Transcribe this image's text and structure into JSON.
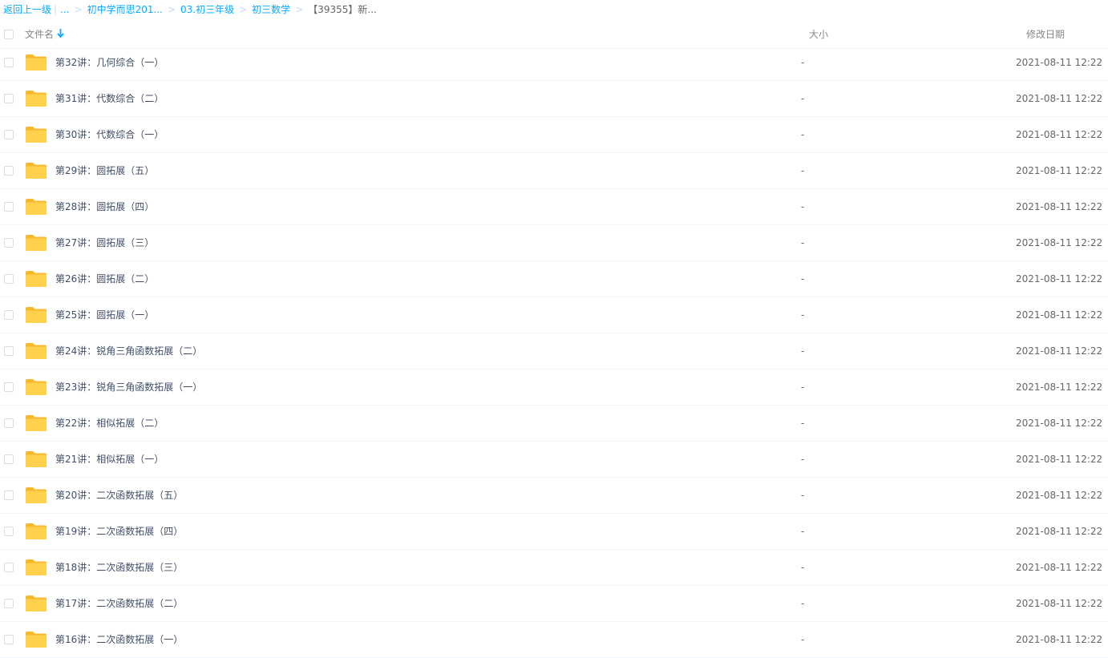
{
  "breadcrumb": {
    "back_label": "返回上一级",
    "pipe": "|",
    "items": [
      "...",
      "初中学而思201...",
      "03.初三年级",
      "初三数学"
    ],
    "current": "【39355】新...",
    "separator": ">"
  },
  "header": {
    "name_label": "文件名",
    "size_label": "大小",
    "date_label": "修改日期",
    "sort_icon": "arrow-down-icon"
  },
  "colors": {
    "accent": "#09aaff",
    "folder": "#ffd04b",
    "text": "#424e67"
  },
  "files": [
    {
      "name": "第32讲：几何综合（一）",
      "size": "-",
      "date": "2021-08-11 12:22"
    },
    {
      "name": "第31讲：代数综合（二）",
      "size": "-",
      "date": "2021-08-11 12:22"
    },
    {
      "name": "第30讲：代数综合（一）",
      "size": "-",
      "date": "2021-08-11 12:22"
    },
    {
      "name": "第29讲：圆拓展（五）",
      "size": "-",
      "date": "2021-08-11 12:22"
    },
    {
      "name": "第28讲：圆拓展（四）",
      "size": "-",
      "date": "2021-08-11 12:22"
    },
    {
      "name": "第27讲：圆拓展（三）",
      "size": "-",
      "date": "2021-08-11 12:22"
    },
    {
      "name": "第26讲：圆拓展（二）",
      "size": "-",
      "date": "2021-08-11 12:22"
    },
    {
      "name": "第25讲：圆拓展（一）",
      "size": "-",
      "date": "2021-08-11 12:22"
    },
    {
      "name": "第24讲：锐角三角函数拓展（二）",
      "size": "-",
      "date": "2021-08-11 12:22"
    },
    {
      "name": "第23讲：锐角三角函数拓展（一）",
      "size": "-",
      "date": "2021-08-11 12:22"
    },
    {
      "name": "第22讲：相似拓展（二）",
      "size": "-",
      "date": "2021-08-11 12:22"
    },
    {
      "name": "第21讲：相似拓展（一）",
      "size": "-",
      "date": "2021-08-11 12:22"
    },
    {
      "name": "第20讲：二次函数拓展（五）",
      "size": "-",
      "date": "2021-08-11 12:22"
    },
    {
      "name": "第19讲：二次函数拓展（四）",
      "size": "-",
      "date": "2021-08-11 12:22"
    },
    {
      "name": "第18讲：二次函数拓展（三）",
      "size": "-",
      "date": "2021-08-11 12:22"
    },
    {
      "name": "第17讲：二次函数拓展（二）",
      "size": "-",
      "date": "2021-08-11 12:22"
    },
    {
      "name": "第16讲：二次函数拓展（一）",
      "size": "-",
      "date": "2021-08-11 12:22"
    }
  ]
}
